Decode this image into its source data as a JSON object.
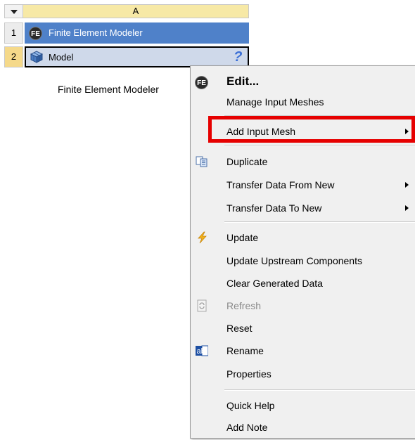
{
  "system": {
    "column_header": "A",
    "rows": [
      {
        "number": "1",
        "label": "Finite Element Modeler",
        "icon": "fe-icon"
      },
      {
        "number": "2",
        "label": "Model",
        "icon": "model-cube-icon",
        "status_icon": "question-mark-icon",
        "status_glyph": "?"
      }
    ],
    "fe_badge_text": "FE",
    "caption": "Finite Element Modeler"
  },
  "context_menu": {
    "items": [
      {
        "label": "Edit...",
        "icon": "fe-icon",
        "bold": true
      },
      {
        "label": "Manage Input Meshes"
      },
      {
        "label": "Add Input Mesh",
        "submenu": true,
        "highlighted": true
      },
      {
        "label": "Duplicate",
        "icon": "duplicate-icon"
      },
      {
        "label": "Transfer Data From New",
        "submenu": true
      },
      {
        "label": "Transfer Data To New",
        "submenu": true
      },
      {
        "label": "Update",
        "icon": "lightning-icon"
      },
      {
        "label": "Update Upstream Components"
      },
      {
        "label": "Clear Generated Data"
      },
      {
        "label": "Refresh",
        "icon": "refresh-icon",
        "disabled": true
      },
      {
        "label": "Reset"
      },
      {
        "label": "Rename",
        "icon": "rename-icon",
        "icon_text": "ab"
      },
      {
        "label": "Properties"
      },
      {
        "label": "Quick Help"
      },
      {
        "label": "Add Note"
      }
    ]
  },
  "colors": {
    "header_bg": "#f7e9a6",
    "selected_row_bg": "#4f81c9",
    "active_row_bg": "#cfd9ea",
    "highlight_border": "#e60000"
  }
}
